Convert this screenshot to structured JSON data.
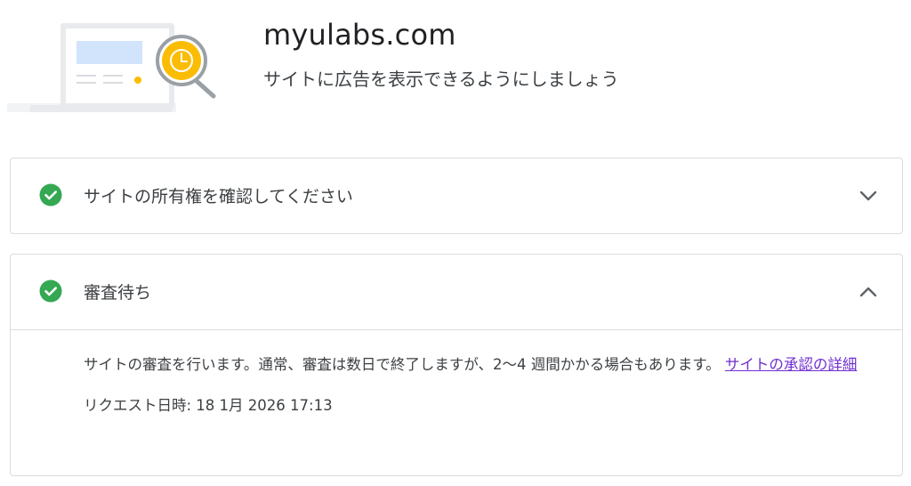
{
  "header": {
    "site_name": "myulabs.com",
    "subtitle": "サイトに広告を表示できるようにしましょう"
  },
  "steps": [
    {
      "title": "サイトの所有権を確認してください",
      "status_icon": "check-circle-icon",
      "expanded": false,
      "toggle_icon": "chevron-down-icon"
    },
    {
      "title": "審査待ち",
      "status_icon": "check-circle-icon",
      "expanded": true,
      "toggle_icon": "chevron-up-icon",
      "description": "サイトの審査を行います。通常、審査は数日で終了しますが、2〜4 週間かかる場合もあります。",
      "link_text": "サイトの承認の詳細",
      "requested_label": "リクエスト日時: 18 1月 2026 17:13"
    }
  ],
  "colors": {
    "check_green": "#34a853",
    "link_purple": "#6f2fd0",
    "border": "#dadce0",
    "illustration_blue": "#d2e3fc",
    "illustration_yellow": "#fbbc04"
  }
}
